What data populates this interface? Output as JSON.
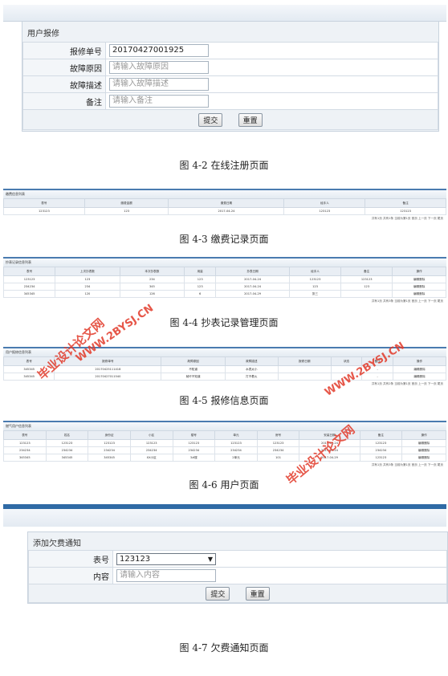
{
  "fig2": {
    "title": "用户报修",
    "rows": [
      {
        "label": "报修单号",
        "value": "20170427001925",
        "placeholder": ""
      },
      {
        "label": "故障原因",
        "value": "",
        "placeholder": "请输入故障原因"
      },
      {
        "label": "故障描述",
        "value": "",
        "placeholder": "请输入故障描述"
      },
      {
        "label": "备注",
        "value": "",
        "placeholder": "请输入备注"
      }
    ],
    "submit": "提交",
    "reset": "重置"
  },
  "captions": {
    "c2": "图 4-2 在线注册页面",
    "c3": "图 4-3 缴费记录页面",
    "c4": "图 4-4 抄表记录管理页面",
    "c5": "图 4-5 报修信息页面",
    "c6": "图 4-6 用户页面",
    "c7": "图 4-7 欠费通知页面"
  },
  "fig3": {
    "title": "缴费信息列表",
    "headers": [
      "表号",
      "缴费金额",
      "缴费日期",
      "经手人",
      "备注"
    ],
    "rows": [
      [
        "123123",
        "123",
        "2017-04-24",
        "123123",
        "123123"
      ]
    ],
    "pager": "共有1页 共有1条 当前为第1页 首页 上一页 下一页 尾页"
  },
  "fig4": {
    "title": "抄表记录信息列表",
    "headers": [
      "表号",
      "上次抄表数",
      "本次抄表数",
      "用量",
      "抄表日期",
      "经手人",
      "备注",
      "操作"
    ],
    "rows": [
      [
        "123123",
        "123",
        "234",
        "123",
        "2017-04-24",
        "123123",
        "123123",
        "编辑删除"
      ],
      [
        "234234",
        "234",
        "345",
        "123",
        "2017-04-24",
        "123",
        "123",
        "编辑删除"
      ],
      [
        "345345",
        "120",
        "126",
        "6",
        "2017-04-29",
        "张三",
        "",
        "编辑删除"
      ]
    ],
    "pager": "共有1页 共有3条 当前为第1页 首页 上一页 下一页 尾页"
  },
  "fig5": {
    "title": "用户报修信息列表",
    "headers": [
      "表号",
      "报修单号",
      "故障原因",
      "故障描述",
      "报修日期",
      "状态",
      "备注",
      "操作"
    ],
    "rows": [
      [
        "345345",
        "20170425111418",
        "不知道",
        "水表太小",
        "",
        "",
        "-",
        "编辑删除"
      ],
      [
        "345345",
        "20170427011540",
        "就坏不知道",
        "打不着火",
        "",
        "",
        "-",
        "编辑删除"
      ]
    ],
    "pager": "共有1页 共有2条 当前为第1页 首页 上一页 下一页 尾页"
  },
  "fig6": {
    "title": "燃气用户信息列表",
    "headers": [
      "表号",
      "姓名",
      "身份证",
      "小区",
      "楼号",
      "单元",
      "房号",
      "安装日期",
      "备注",
      "操作"
    ],
    "rows": [
      [
        "123123",
        "123123",
        "123123",
        "123123",
        "123123",
        "123123",
        "123123",
        "2017-04-24",
        "123123",
        "编辑删除"
      ],
      [
        "234234",
        "234234",
        "234234",
        "234234",
        "234234",
        "234234",
        "234234",
        "2017-04-24",
        "234234",
        "编辑删除"
      ],
      [
        "345345",
        "345345",
        "345345",
        "XX小区",
        "3#楼",
        "2单元",
        "101",
        "2017-04-29",
        "123123",
        "编辑删除"
      ]
    ],
    "pager": "共有1页 共有3条 当前为第1页 首页 上一页 下一页 尾页"
  },
  "fig7": {
    "title": "添加欠费通知",
    "meter_label": "表号",
    "meter_value": "123123",
    "content_label": "内容",
    "content_placeholder": "请输入内容",
    "submit": "提交",
    "reset": "重置"
  },
  "watermarks": {
    "cn": "毕业设计论文网",
    "url": "WWW.2BYSJ.CN"
  },
  "colors": {
    "accent": "#2f6aa5",
    "watermark": "#e23a2a"
  }
}
